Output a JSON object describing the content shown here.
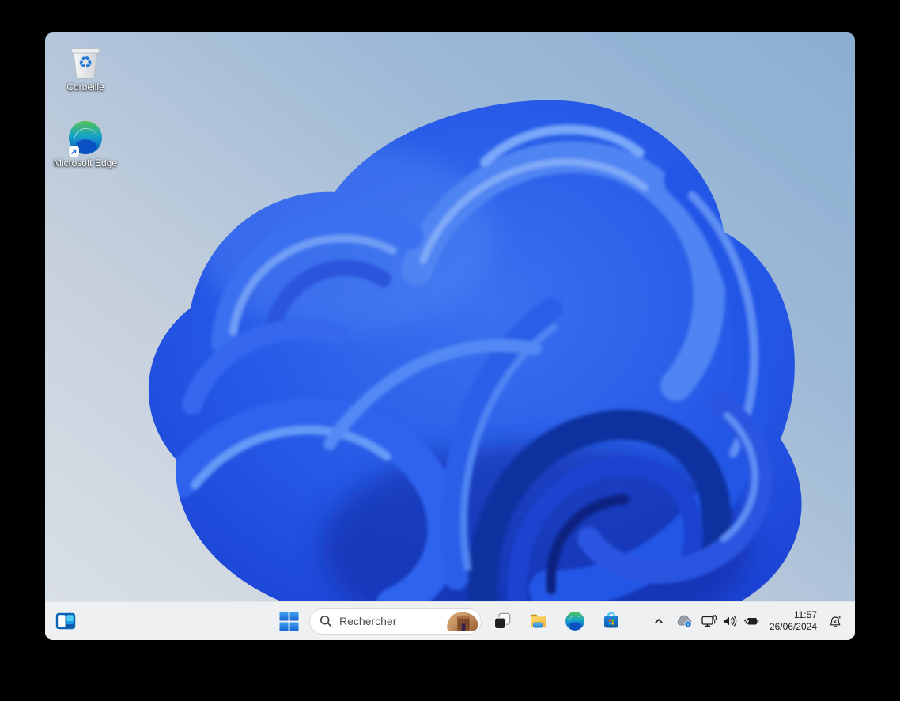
{
  "desktop": {
    "icons": [
      {
        "label": "Corbeille",
        "icon": "recycle-bin-icon"
      },
      {
        "label": "Microsoft Edge",
        "icon": "edge-logo-icon"
      }
    ]
  },
  "taskbar": {
    "widgets_button": {
      "icon": "widgets-icon"
    },
    "start_button": {
      "icon": "windows-start-icon"
    },
    "search": {
      "placeholder": "Rechercher",
      "icon": "search-icon",
      "image": "bing-daily-image-petra"
    },
    "app_buttons": [
      {
        "icon": "task-view-icon"
      },
      {
        "icon": "file-explorer-icon"
      },
      {
        "icon": "edge-logo-icon"
      },
      {
        "icon": "microsoft-store-icon"
      }
    ],
    "tray": {
      "chevron": "hidden-icons-chevron",
      "onedrive": "onedrive-cloud-icon",
      "network": "network-icon",
      "volume": "volume-icon",
      "battery": "battery-charging-icon",
      "clock": {
        "time": "11:57",
        "date": "26/06/2024"
      },
      "notifications": "do-not-disturb-bell-icon"
    }
  },
  "colors": {
    "frame_background": "#000000",
    "taskbar_background": "#eef0f2",
    "wallpaper_top_right": "#8bafd2",
    "wallpaper_bottom_left": "#dce1e8",
    "bloom_blue_mid": "#2a5fe8",
    "bloom_blue_dark": "#11309f",
    "bloom_blue_light": "#78a7fa",
    "accent_blue": "#1565c0"
  }
}
